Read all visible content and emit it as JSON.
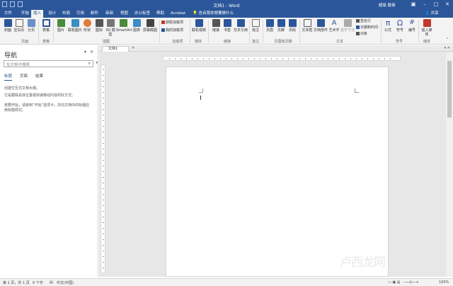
{
  "window": {
    "title": "文档1 - Word",
    "user": "超级 勤奋",
    "min": "–",
    "max": "□",
    "close": "✕",
    "options": "▣"
  },
  "tabs": [
    "文件",
    "开始",
    "插入",
    "设计",
    "布局",
    "引用",
    "邮件",
    "审阅",
    "视图",
    "办公标签",
    "帮助",
    "Acrobat"
  ],
  "active_tab": "插入",
  "tell_me": "告诉我你想要做什么",
  "share": "共享",
  "ribbon": {
    "buttons": [
      {
        "id": "cover",
        "label": "封面",
        "icon": "cover-page-icon",
        "color": "#2b579a"
      },
      {
        "id": "blank",
        "label": "空白页",
        "icon": "blank-page-icon",
        "color": "#ffffff"
      },
      {
        "id": "pagebreak",
        "label": "分页",
        "icon": "page-break-icon",
        "color": "#6d8fc7"
      },
      {
        "id": "table",
        "label": "表格",
        "icon": "table-icon",
        "color": "#2b579a"
      },
      {
        "id": "picture",
        "label": "图片",
        "icon": "picture-icon",
        "color": "#4a8a3b"
      },
      {
        "id": "onlinepic",
        "label": "联机图片",
        "icon": "online-picture-icon",
        "color": "#3c8dc5"
      },
      {
        "id": "shapes",
        "label": "形状",
        "icon": "shapes-icon",
        "color": "#e07b39"
      },
      {
        "id": "icons",
        "label": "图标",
        "icon": "icons-icon",
        "color": "#555555"
      },
      {
        "id": "3d",
        "label": "3D 模型",
        "icon": "3d-model-icon",
        "color": "#777777"
      },
      {
        "id": "smartart",
        "label": "SmartArt",
        "icon": "smartart-icon",
        "color": "#4a8a3b"
      },
      {
        "id": "chart",
        "label": "图表",
        "icon": "chart-icon",
        "color": "#3c8dc5"
      },
      {
        "id": "screenshot",
        "label": "屏幕截图",
        "icon": "screenshot-icon",
        "color": "#444444"
      },
      {
        "id": "onlinevideo",
        "label": "联机视频",
        "icon": "online-video-icon",
        "color": "#2b579a"
      },
      {
        "id": "link",
        "label": "链接",
        "icon": "link-icon",
        "color": "#555555"
      },
      {
        "id": "bookmark",
        "label": "书签",
        "icon": "bookmark-icon",
        "color": "#2b579a"
      },
      {
        "id": "crossref",
        "label": "交叉引用",
        "icon": "cross-reference-icon",
        "color": "#2b579a"
      },
      {
        "id": "comment",
        "label": "批注",
        "icon": "comment-icon",
        "color": "#dcdcdc"
      },
      {
        "id": "header",
        "label": "页眉",
        "icon": "header-icon",
        "color": "#2b579a"
      },
      {
        "id": "footer",
        "label": "页脚",
        "icon": "footer-icon",
        "color": "#2b579a"
      },
      {
        "id": "pagenum",
        "label": "页码",
        "icon": "page-number-icon",
        "color": "#2b579a"
      },
      {
        "id": "textbox",
        "label": "文本框",
        "icon": "text-box-icon",
        "color": "#555555"
      },
      {
        "id": "quickparts",
        "label": "文档部件",
        "icon": "quick-parts-icon",
        "color": "#2b579a"
      },
      {
        "id": "wordart",
        "label": "艺术字",
        "icon": "wordart-icon",
        "color": "#2b579a"
      },
      {
        "id": "dropcap",
        "label": "首字下沉",
        "icon": "drop-cap-icon",
        "color": "#aaaaaa"
      },
      {
        "id": "equation",
        "label": "公式",
        "icon": "equation-icon",
        "color": "#2b579a"
      },
      {
        "id": "symbol",
        "label": "符号",
        "icon": "symbol-icon",
        "color": "#2b579a"
      },
      {
        "id": "number",
        "label": "编号",
        "icon": "number-icon",
        "color": "#2b579a"
      },
      {
        "id": "embed",
        "label": "插入媒体",
        "icon": "embed-media-icon",
        "color": "#c0392b"
      }
    ],
    "small": {
      "getaddins": "获取加载项",
      "myaddins": "我的加载项",
      "signature": "签名行",
      "datetime": "日期和时间",
      "object": "对象"
    },
    "groups": [
      "页面",
      "表格",
      "插图",
      "加载项",
      "媒体",
      "链接",
      "批注",
      "页眉和页脚",
      "文本",
      "符号",
      "媒体"
    ]
  },
  "nav": {
    "title": "导航",
    "search_placeholder": "在文档中搜索",
    "tabs": [
      "标题",
      "页面",
      "结果"
    ],
    "hint1": "创建交互式文档大纲。",
    "hint2": "它是跟踪具体位置或快速移动内容的好方式。",
    "hint3": "若要开始，请转到“开始”选项卡，并向文档中的标题应用标题样式。"
  },
  "doc_tab": "文档1",
  "status": {
    "page": "第 1 页，共 1 页",
    "words": "0 个字",
    "lang": "中文(中国)",
    "zoom": "100%"
  },
  "watermark": "卢西龙网"
}
